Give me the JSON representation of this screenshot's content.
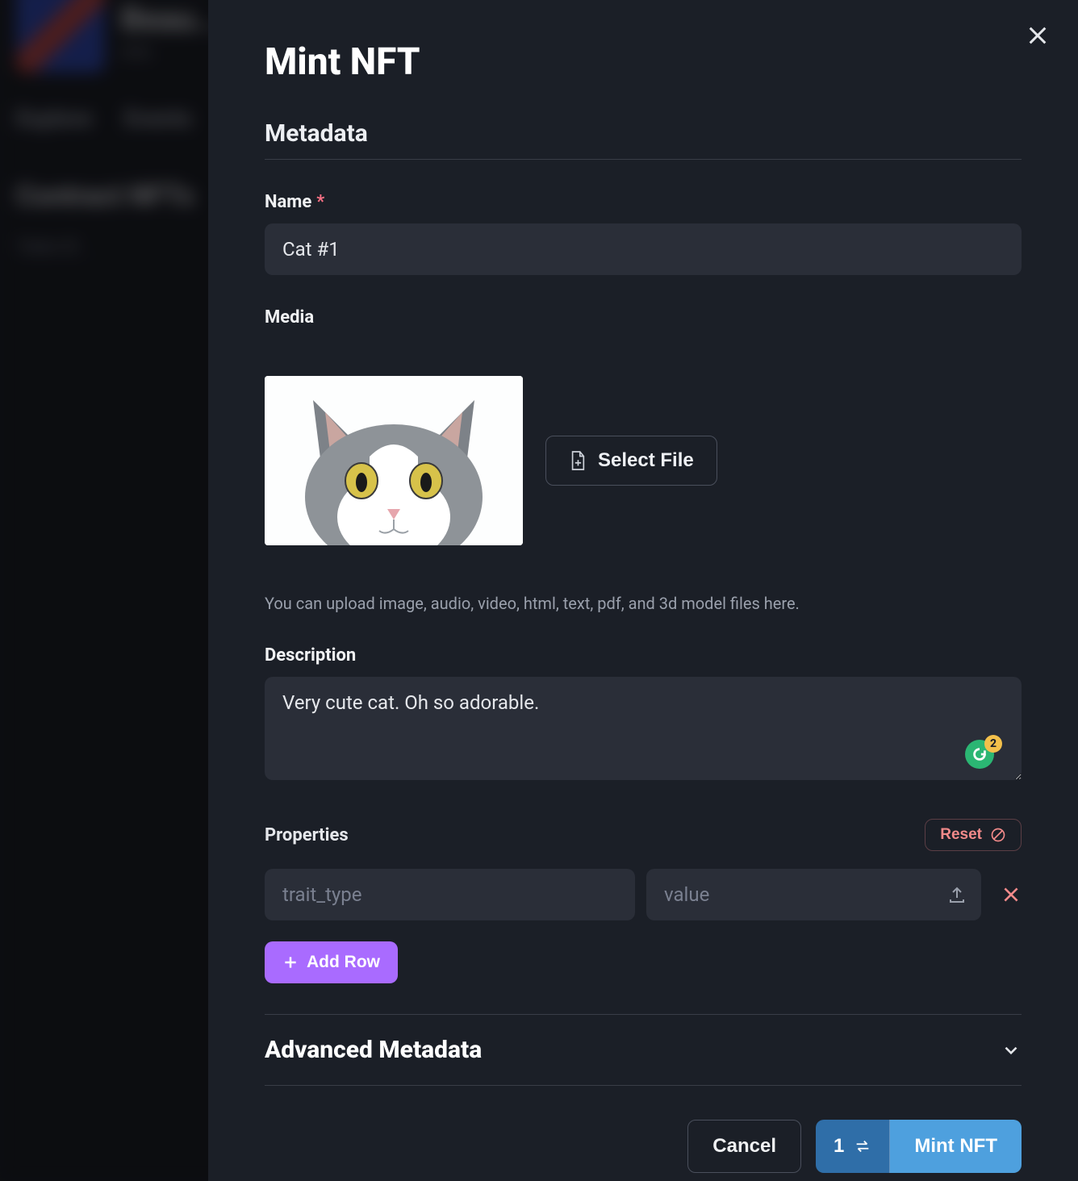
{
  "background": {
    "title": "Beau...",
    "subtitle": "Info",
    "tabs": [
      "Explore",
      "Events"
    ],
    "section": "Contract NFTs",
    "col1": "Token ID"
  },
  "modal": {
    "title": "Mint NFT",
    "section_metadata": "Metadata",
    "name": {
      "label": "Name",
      "required": "*",
      "value": "Cat #1"
    },
    "media": {
      "label": "Media",
      "select_file": "Select File",
      "hint": "You can upload image, audio, video, html, text, pdf, and 3d model files here."
    },
    "description": {
      "label": "Description",
      "value": "Very cute cat. Oh so adorable.",
      "grammarly_count": "2"
    },
    "properties": {
      "label": "Properties",
      "reset": "Reset",
      "trait_placeholder": "trait_type",
      "value_placeholder": "value",
      "add_row": "Add Row"
    },
    "advanced": "Advanced Metadata",
    "footer": {
      "cancel": "Cancel",
      "qty": "1",
      "mint": "Mint NFT"
    }
  }
}
